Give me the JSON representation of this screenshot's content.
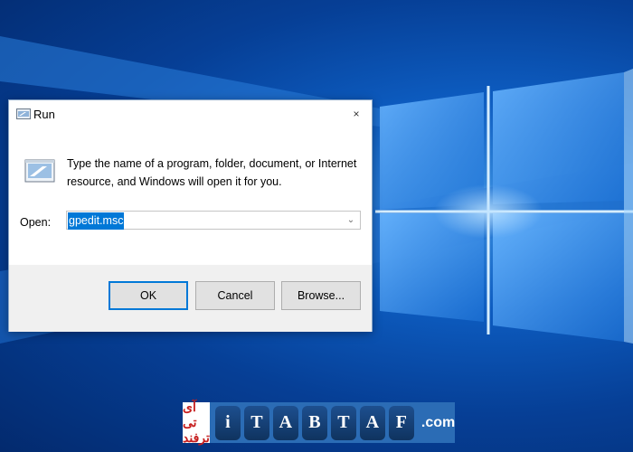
{
  "dialog": {
    "title": "Run",
    "close_glyph": "×",
    "description": "Type the name of a program, folder, document, or Internet resource, and Windows will open it for you.",
    "open_label": "Open:",
    "open_value": "gpedit.msc",
    "dropdown_glyph": "⌄",
    "buttons": {
      "ok": "OK",
      "cancel": "Cancel",
      "browse": "Browse..."
    }
  },
  "watermark": {
    "brand_text": "آی تی ترفند",
    "letters": [
      "i",
      "T",
      "A",
      "B",
      "T",
      "A",
      "F"
    ],
    "suffix": ".com"
  },
  "colors": {
    "accent": "#0078d7",
    "wallpaper": "#0d5cc0",
    "brand_red": "#c61e1e"
  },
  "icons": {
    "title": "run-icon",
    "main": "run-icon",
    "close": "close-icon",
    "dropdown": "chevron-down-icon"
  }
}
